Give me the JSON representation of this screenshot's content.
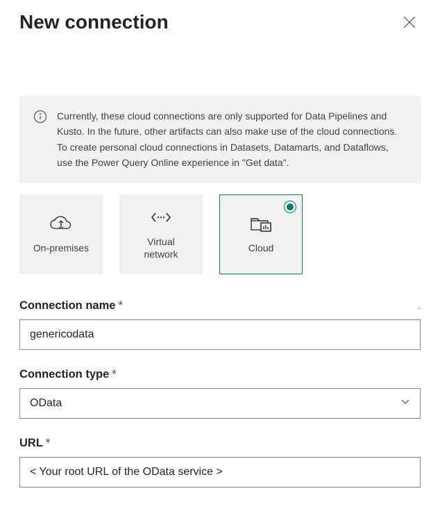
{
  "header": {
    "title": "New connection"
  },
  "info": {
    "text": "Currently, these cloud connections are only supported for Data Pipelines and Kusto. In the future, other artifacts can also make use of the cloud connections. To create personal cloud connections in Datasets, Datamarts, and Dataflows, use the Power Query Online experience in \"Get data\"."
  },
  "tiles": {
    "onprem": {
      "label": "On-premises"
    },
    "vnet": {
      "label": "Virtual network"
    },
    "cloud": {
      "label": "Cloud"
    }
  },
  "fields": {
    "connection_name": {
      "label": "Connection name",
      "value": "genericodata"
    },
    "connection_type": {
      "label": "Connection type",
      "value": "OData"
    },
    "url": {
      "label": "URL",
      "value": "< Your root URL of the OData service >"
    }
  }
}
